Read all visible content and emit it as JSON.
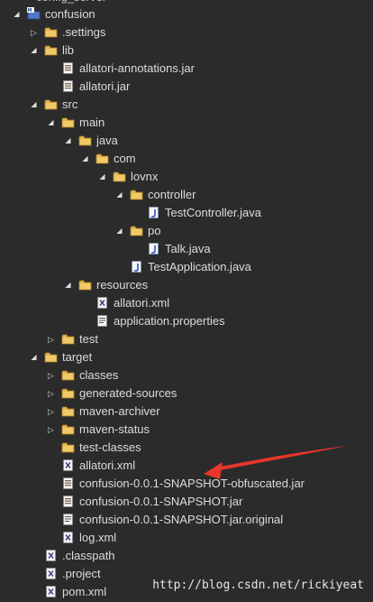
{
  "header": {
    "cut_title": "config_server"
  },
  "colors": {
    "annotation_arrow": "#e8362b",
    "background": "#2b2b2b"
  },
  "watermark": "http://blog.csdn.net/rickiyeat",
  "tree": [
    {
      "name": "project-root",
      "label": "confusion",
      "depth": 0,
      "expand": "open",
      "icon": "maven-project-icon"
    },
    {
      "name": "folder-settings",
      "label": ".settings",
      "depth": 1,
      "expand": "closed",
      "icon": "folder-icon"
    },
    {
      "name": "folder-lib",
      "label": "lib",
      "depth": 1,
      "expand": "open",
      "icon": "folder-icon"
    },
    {
      "name": "file-allatori-annotations-jar",
      "label": "allatori-annotations.jar",
      "depth": 2,
      "expand": "none",
      "icon": "jar-file-icon"
    },
    {
      "name": "file-allatori-jar",
      "label": "allatori.jar",
      "depth": 2,
      "expand": "none",
      "icon": "jar-file-icon"
    },
    {
      "name": "folder-src",
      "label": "src",
      "depth": 1,
      "expand": "open",
      "icon": "folder-icon"
    },
    {
      "name": "folder-main",
      "label": "main",
      "depth": 2,
      "expand": "open",
      "icon": "folder-icon"
    },
    {
      "name": "folder-java",
      "label": "java",
      "depth": 3,
      "expand": "open",
      "icon": "folder-icon"
    },
    {
      "name": "folder-com",
      "label": "com",
      "depth": 4,
      "expand": "open",
      "icon": "folder-icon"
    },
    {
      "name": "folder-lovnx",
      "label": "lovnx",
      "depth": 5,
      "expand": "open",
      "icon": "folder-icon"
    },
    {
      "name": "folder-controller",
      "label": "controller",
      "depth": 6,
      "expand": "open",
      "icon": "folder-icon"
    },
    {
      "name": "file-testcontroller-java",
      "label": "TestController.java",
      "depth": 7,
      "expand": "none",
      "icon": "java-file-icon"
    },
    {
      "name": "folder-po",
      "label": "po",
      "depth": 6,
      "expand": "open",
      "icon": "folder-icon"
    },
    {
      "name": "file-talk-java",
      "label": "Talk.java",
      "depth": 7,
      "expand": "none",
      "icon": "java-file-icon"
    },
    {
      "name": "file-testapplication-java",
      "label": "TestApplication.java",
      "depth": 6,
      "expand": "none",
      "icon": "java-file-icon"
    },
    {
      "name": "folder-resources",
      "label": "resources",
      "depth": 3,
      "expand": "open",
      "icon": "folder-icon"
    },
    {
      "name": "file-allatori-xml-res",
      "label": "allatori.xml",
      "depth": 4,
      "expand": "none",
      "icon": "xml-file-icon"
    },
    {
      "name": "file-application-properties",
      "label": "application.properties",
      "depth": 4,
      "expand": "none",
      "icon": "properties-file-icon"
    },
    {
      "name": "folder-test",
      "label": "test",
      "depth": 2,
      "expand": "closed",
      "icon": "folder-icon"
    },
    {
      "name": "folder-target",
      "label": "target",
      "depth": 1,
      "expand": "open",
      "icon": "folder-icon"
    },
    {
      "name": "folder-classes",
      "label": "classes",
      "depth": 2,
      "expand": "closed",
      "icon": "folder-icon"
    },
    {
      "name": "folder-generated-sources",
      "label": "generated-sources",
      "depth": 2,
      "expand": "closed",
      "icon": "folder-icon"
    },
    {
      "name": "folder-maven-archiver",
      "label": "maven-archiver",
      "depth": 2,
      "expand": "closed",
      "icon": "folder-icon"
    },
    {
      "name": "folder-maven-status",
      "label": "maven-status",
      "depth": 2,
      "expand": "closed",
      "icon": "folder-icon"
    },
    {
      "name": "folder-test-classes",
      "label": "test-classes",
      "depth": 2,
      "expand": "none",
      "icon": "folder-icon"
    },
    {
      "name": "file-allatori-xml-target",
      "label": "allatori.xml",
      "depth": 2,
      "expand": "none",
      "icon": "xml-file-icon"
    },
    {
      "name": "file-obfuscated-jar",
      "label": "confusion-0.0.1-SNAPSHOT-obfuscated.jar",
      "depth": 2,
      "expand": "none",
      "icon": "jar-file-icon"
    },
    {
      "name": "file-snapshot-jar",
      "label": "confusion-0.0.1-SNAPSHOT.jar",
      "depth": 2,
      "expand": "none",
      "icon": "jar-file-icon"
    },
    {
      "name": "file-snapshot-jar-original",
      "label": "confusion-0.0.1-SNAPSHOT.jar.original",
      "depth": 2,
      "expand": "none",
      "icon": "text-file-icon"
    },
    {
      "name": "file-log-xml",
      "label": "log.xml",
      "depth": 2,
      "expand": "none",
      "icon": "xml-file-icon"
    },
    {
      "name": "file-classpath",
      "label": ".classpath",
      "depth": 1,
      "expand": "none",
      "icon": "xml-file-icon"
    },
    {
      "name": "file-project",
      "label": ".project",
      "depth": 1,
      "expand": "none",
      "icon": "xml-file-icon"
    },
    {
      "name": "file-pom-xml",
      "label": "pom.xml",
      "depth": 1,
      "expand": "none",
      "icon": "xml-file-icon"
    }
  ]
}
